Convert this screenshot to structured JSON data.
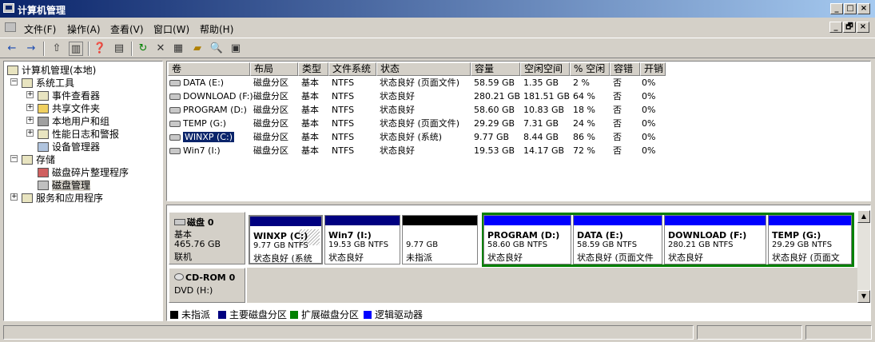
{
  "window": {
    "title": "计算机管理",
    "controls": [
      "_",
      "□",
      "×"
    ]
  },
  "menu": {
    "items": [
      "文件(F)",
      "操作(A)",
      "查看(V)",
      "窗口(W)",
      "帮助(H)"
    ],
    "doc_controls": [
      "_",
      "🗗",
      "×"
    ]
  },
  "toolbar": {
    "icons": [
      "back-arrow-icon",
      "forward-arrow-icon",
      "up-folder-icon",
      "show-hide-tree-icon",
      "properties-icon",
      "help-icon",
      "refresh-icon",
      "delete-icon",
      "disk-properties-icon",
      "open-icon",
      "search-icon",
      "settings-icon"
    ]
  },
  "tree": {
    "root": "计算机管理(本地)",
    "system_tools": "系统工具",
    "event_viewer": "事件查看器",
    "shared_folders": "共享文件夹",
    "local_users": "本地用户和组",
    "perf_logs": "性能日志和警报",
    "device_manager": "设备管理器",
    "storage": "存储",
    "defrag": "磁盘碎片整理程序",
    "disk_mgmt": "磁盘管理",
    "services": "服务和应用程序"
  },
  "list": {
    "headers": [
      "卷",
      "布局",
      "类型",
      "文件系统",
      "状态",
      "容量",
      "空闲空间",
      "% 空闲",
      "容错",
      "开销"
    ],
    "rows": [
      {
        "vol": "DATA (E:)",
        "layout": "磁盘分区",
        "type": "基本",
        "fs": "NTFS",
        "status": "状态良好 (页面文件)",
        "cap": "58.59 GB",
        "free": "1.35 GB",
        "pct": "2 %",
        "ft": "否",
        "ovh": "0%"
      },
      {
        "vol": "DOWNLOAD (F:)",
        "layout": "磁盘分区",
        "type": "基本",
        "fs": "NTFS",
        "status": "状态良好",
        "cap": "280.21 GB",
        "free": "181.51 GB",
        "pct": "64 %",
        "ft": "否",
        "ovh": "0%"
      },
      {
        "vol": "PROGRAM (D:)",
        "layout": "磁盘分区",
        "type": "基本",
        "fs": "NTFS",
        "status": "状态良好",
        "cap": "58.60 GB",
        "free": "10.83 GB",
        "pct": "18 %",
        "ft": "否",
        "ovh": "0%"
      },
      {
        "vol": "TEMP (G:)",
        "layout": "磁盘分区",
        "type": "基本",
        "fs": "NTFS",
        "status": "状态良好 (页面文件)",
        "cap": "29.29 GB",
        "free": "7.31 GB",
        "pct": "24 %",
        "ft": "否",
        "ovh": "0%"
      },
      {
        "vol": "WINXP (C:)",
        "layout": "磁盘分区",
        "type": "基本",
        "fs": "NTFS",
        "status": "状态良好 (系统)",
        "cap": "9.77 GB",
        "free": "8.44 GB",
        "pct": "86 %",
        "ft": "否",
        "ovh": "0%"
      },
      {
        "vol": "Win7 (I:)",
        "layout": "磁盘分区",
        "type": "基本",
        "fs": "NTFS",
        "status": "状态良好",
        "cap": "19.53 GB",
        "free": "14.17 GB",
        "pct": "72 %",
        "ft": "否",
        "ovh": "0%"
      }
    ]
  },
  "disks": {
    "disk0": {
      "name": "磁盘 0",
      "type": "基本",
      "size": "465.76 GB",
      "state": "联机"
    },
    "cdrom0": {
      "name": "CD-ROM 0",
      "sub": "DVD (H:)"
    },
    "partitions": [
      {
        "name": "WINXP  (C:)",
        "size": "9.77 GB NTFS",
        "status": "状态良好 (系统",
        "bar_color": "#000080"
      },
      {
        "name": "Win7  (I:)",
        "size": "19.53 GB NTFS",
        "status": "状态良好",
        "bar_color": "#000080"
      },
      {
        "name": "",
        "size": "9.77 GB",
        "status": "未指派",
        "bar_color": "#000000"
      },
      {
        "name": "PROGRAM  (D:)",
        "size": "58.60 GB NTFS",
        "status": "状态良好",
        "bar_color": "#0000ff"
      },
      {
        "name": "DATA  (E:)",
        "size": "58.59 GB NTFS",
        "status": "状态良好 (页面文件",
        "bar_color": "#0000ff"
      },
      {
        "name": "DOWNLOAD  (F:)",
        "size": "280.21 GB NTFS",
        "status": "状态良好",
        "bar_color": "#0000ff"
      },
      {
        "name": "TEMP  (G:)",
        "size": "29.29 GB NTFS",
        "status": "状态良好 (页面文",
        "bar_color": "#0000ff"
      }
    ]
  },
  "legend": [
    {
      "label": "未指派",
      "color": "#000000"
    },
    {
      "label": "主要磁盘分区",
      "color": "#000080"
    },
    {
      "label": "扩展磁盘分区",
      "color": "#008000"
    },
    {
      "label": "逻辑驱动器",
      "color": "#0000ff"
    }
  ]
}
